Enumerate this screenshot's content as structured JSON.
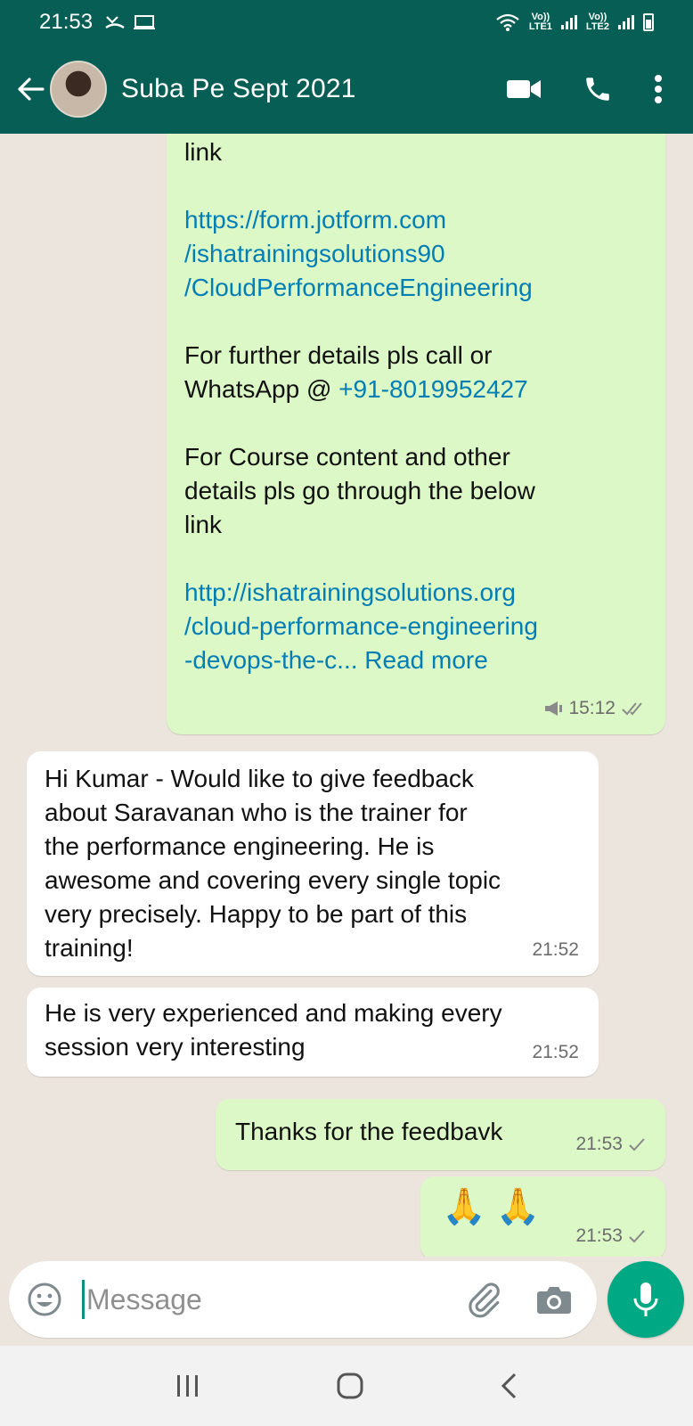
{
  "status_bar": {
    "time": "21:53",
    "net1": "Vo))\nLTE1",
    "net2": "Vo))\nLTE2"
  },
  "header": {
    "title": "Suba Pe Sept 2021",
    "back_icon": "arrow-left-icon",
    "video_icon": "video-camera-icon",
    "call_icon": "phone-icon",
    "menu_icon": "more-vertical-icon"
  },
  "messages": [
    {
      "direction": "outgoing",
      "paragraphs": [
        {
          "text": "link"
        },
        {
          "link_lines": [
            "https://form.jotform.com",
            "/ishatrainingsolutions90",
            "/CloudPerformanceEngineering"
          ]
        },
        {
          "lines": [
            "For further details pls call or"
          ],
          "mixed": {
            "text": "WhatsApp @ ",
            "link": "+91-8019952427"
          }
        },
        {
          "lines": [
            "For Course content and other",
            "details pls go through the below",
            "link"
          ]
        },
        {
          "link_lines": [
            "http://ishatrainingsolutions.org",
            "/cloud-performance-engineering"
          ],
          "tail": {
            "link": "-devops-the-c...",
            "more": " Read more"
          }
        }
      ],
      "time": "15:12",
      "forwarded_icon": "broadcast-icon",
      "status": "read"
    },
    {
      "direction": "incoming",
      "lines": [
        "Hi Kumar - Would like to give feedback",
        "about Saravanan who is the trainer for",
        "the performance engineering. He is",
        "awesome and covering every single topic",
        "very precisely. Happy to be part of this",
        "training!"
      ],
      "time": "21:52"
    },
    {
      "direction": "incoming",
      "lines": [
        "He is very experienced and making every",
        "session very interesting"
      ],
      "time": "21:52"
    },
    {
      "direction": "outgoing",
      "text": "Thanks for the feedbavk",
      "time": "21:53",
      "status": "sent"
    },
    {
      "direction": "outgoing",
      "text": "🙏 🙏",
      "time": "21:53",
      "status": "sent"
    }
  ],
  "composer": {
    "placeholder": "Message",
    "emoji_icon": "emoji-icon",
    "attach_icon": "paperclip-icon",
    "camera_icon": "camera-icon",
    "mic_icon": "microphone-icon"
  },
  "nav": {
    "recents_icon": "recents-icon",
    "home_icon": "home-icon",
    "back_icon": "back-icon"
  },
  "colors": {
    "header": "#075e54",
    "outgoing_bubble": "#dcf8c6",
    "incoming_bubble": "#ffffff",
    "link": "#027eb5",
    "accent": "#00a884"
  }
}
